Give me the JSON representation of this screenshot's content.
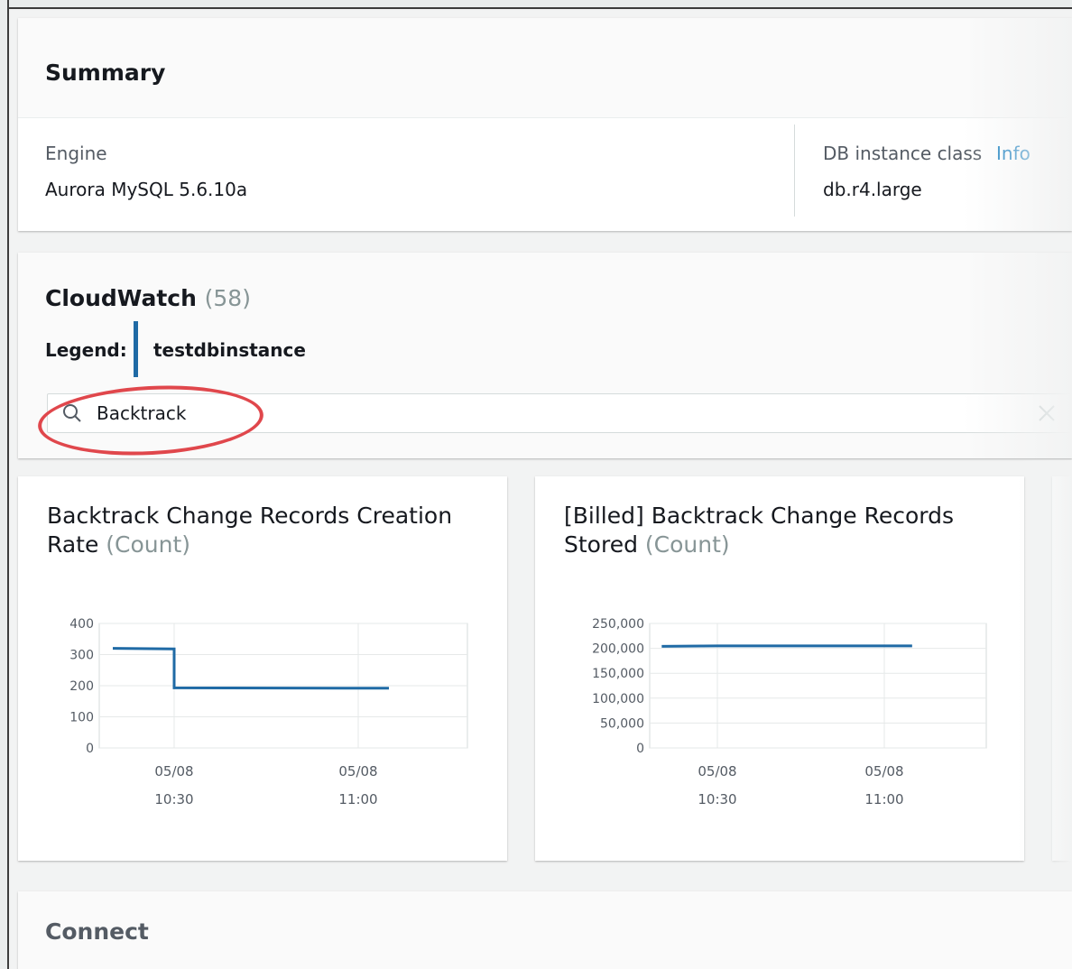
{
  "summary": {
    "title": "Summary",
    "engine_label": "Engine",
    "engine_value": "Aurora MySQL 5.6.10a",
    "class_label": "DB instance class",
    "info_link": "Info",
    "class_value": "db.r4.large"
  },
  "cloudwatch": {
    "title": "CloudWatch",
    "count": "(58)",
    "legend_label": "Legend:",
    "legend_item": "testdbinstance",
    "search_value": "Backtrack"
  },
  "metrics": [
    {
      "title": "Backtrack Change Records Creation Rate",
      "unit": "(Count)"
    },
    {
      "title": "[Billed] Backtrack Change Records Stored",
      "unit": "(Count)"
    }
  ],
  "connect": {
    "title": "Connect"
  },
  "colors": {
    "series": "#1f6aa5",
    "annotation": "#e0474c",
    "link": "#0073bb"
  },
  "chart_data": [
    {
      "type": "line",
      "title": "Backtrack Change Records Creation Rate (Count)",
      "series": [
        {
          "name": "testdbinstance",
          "x": [
            "05/08 10:20",
            "05/08 10:30",
            "05/08 10:30",
            "05/08 11:05"
          ],
          "y": [
            320,
            318,
            193,
            192
          ]
        }
      ],
      "ylim": [
        0,
        400
      ],
      "yticks": [
        "400",
        "300",
        "200",
        "100",
        "0"
      ],
      "xticks": [
        [
          "05/08",
          "10:30"
        ],
        [
          "05/08",
          "11:00"
        ]
      ],
      "grid": true
    },
    {
      "type": "line",
      "title": "[Billed] Backtrack Change Records Stored (Count)",
      "series": [
        {
          "name": "testdbinstance",
          "x": [
            "05/08 10:20",
            "05/08 10:30",
            "05/08 11:05"
          ],
          "y": [
            204000,
            205000,
            205000
          ]
        }
      ],
      "ylim": [
        0,
        250000
      ],
      "yticks": [
        "250,000",
        "200,000",
        "150,000",
        "100,000",
        "50,000",
        "0"
      ],
      "xticks": [
        [
          "05/08",
          "10:30"
        ],
        [
          "05/08",
          "11:00"
        ]
      ],
      "grid": true
    }
  ]
}
